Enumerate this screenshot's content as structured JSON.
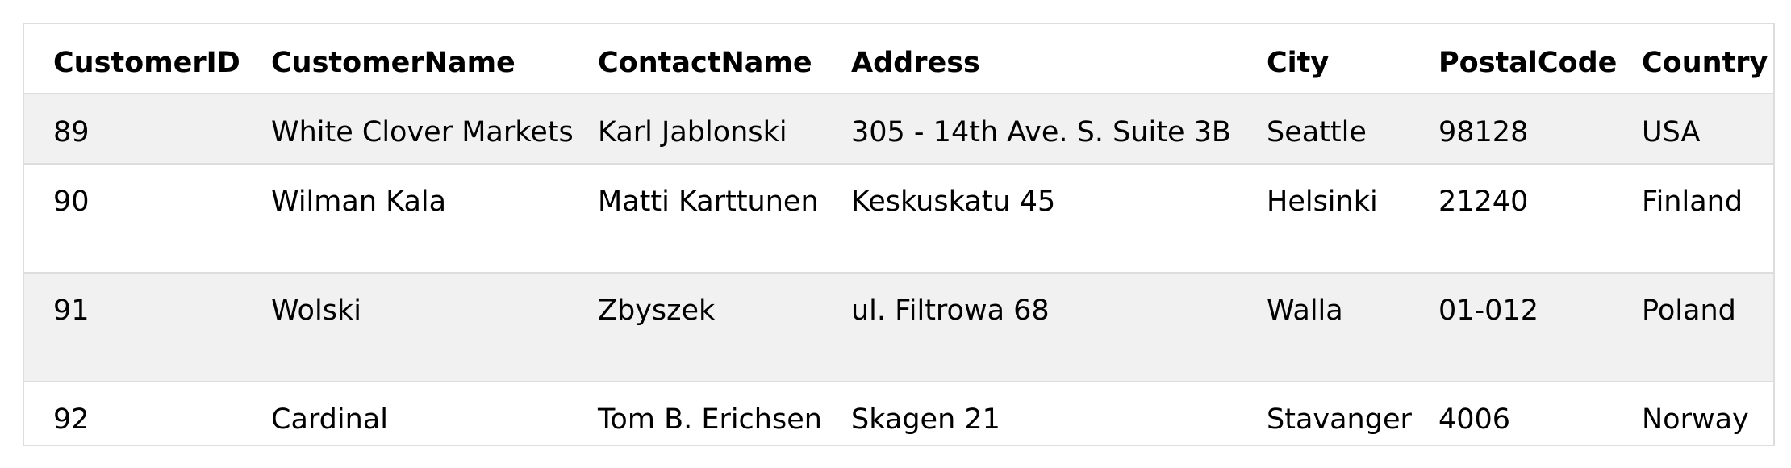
{
  "table": {
    "headers": [
      "CustomerID",
      "CustomerName",
      "ContactName",
      "Address",
      "City",
      "PostalCode",
      "Country"
    ],
    "rows": [
      [
        "89",
        "White Clover Markets",
        "Karl Jablonski",
        "305 - 14th Ave. S. Suite 3B",
        "Seattle",
        "98128",
        "USA"
      ],
      [
        "90",
        "Wilman Kala",
        "Matti Karttunen",
        "Keskuskatu 45",
        "Helsinki",
        "21240",
        "Finland"
      ],
      [
        "91",
        "Wolski",
        "Zbyszek",
        "ul. Filtrowa 68",
        "Walla",
        "01-012",
        "Poland"
      ],
      [
        "92",
        "Cardinal",
        "Tom B. Erichsen",
        "Skagen 21",
        "Stavanger",
        "4006",
        "Norway"
      ]
    ]
  }
}
